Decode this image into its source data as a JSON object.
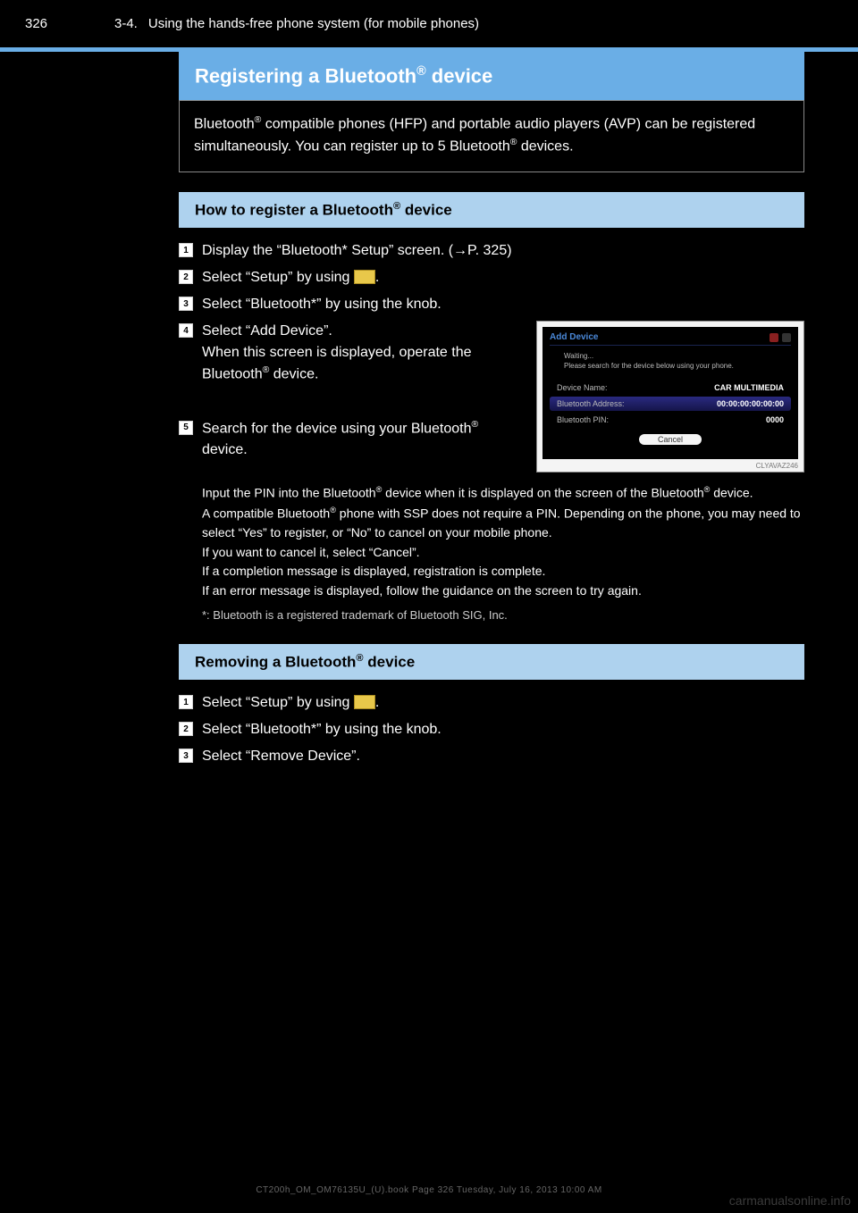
{
  "header": {
    "page_number": "326",
    "section_code": "3-4.",
    "section_title": "Using the hands-free phone system (for mobile phones)"
  },
  "title": {
    "prefix": "Registering a Bluetooth",
    "reg_mark": "®",
    "suffix": " device"
  },
  "intro": {
    "line1_pre": "Bluetooth",
    "line1_post": " compatible phones (HFP) and portable audio players (AVP) can",
    "line2_pre": "be registered simultaneously. You can register up to 5 Bluetooth",
    "line2_post": " devices."
  },
  "sub1": {
    "prefix": "How to register a Bluetooth",
    "suffix": " device"
  },
  "steps1": [
    {
      "n": "1",
      "text": "Display the “Bluetooth* Setup” screen. (→P. 325)"
    },
    {
      "n": "2",
      "text_pre": "Select “Setup” by using ",
      "has_menu_btn": true,
      "text_post": "."
    },
    {
      "n": "3",
      "text": "Select “Bluetooth*” by using the knob."
    },
    {
      "n": "4",
      "text_pre": "Select “Add Device”.",
      "extra": "When this screen is displayed, operate the Bluetooth",
      "reg": "®",
      "extra2": " device."
    },
    {
      "n": "5",
      "text_pre": "Search for the device using your Bluetooth",
      "reg": "®",
      "text_post": " device."
    }
  ],
  "note1": {
    "t1_pre": "Input the PIN into the Bluetooth",
    "t1_post": " device when it is displayed on the screen of the Bluetooth",
    "t1_end": " device.",
    "t2_pre": "A compatible Bluetooth",
    "t2_post": " phone with SSP does not require a PIN. Depending on the phone, you may need to select “Yes” to register, or “No” to cancel on your mobile phone.",
    "t3_pre": "If you want to cancel it, select “Cancel”.",
    "t4_pre": "If a completion message is displayed, registration is complete.",
    "t5_pre": "If an error message is displayed, follow the guidance on the screen to try again.",
    "footnote": "*: Bluetooth is a registered trademark of Bluetooth SIG, Inc."
  },
  "sub2": {
    "prefix": "Removing a Bluetooth",
    "suffix": " device"
  },
  "steps2": [
    {
      "n": "1",
      "text_pre": "Select “Setup” by using ",
      "has_menu_btn": true,
      "text_post": "."
    },
    {
      "n": "2",
      "text": "Select “Bluetooth*” by using the knob."
    },
    {
      "n": "3",
      "text": "Select “Remove Device”."
    }
  ],
  "screenshot": {
    "title": "Add Device",
    "waiting": "Waiting...",
    "prompt": "Please search for the device below using your phone.",
    "rows": [
      {
        "label": "Device Name:",
        "value": "CAR MULTIMEDIA"
      },
      {
        "label": "Bluetooth Address:",
        "value": "00:00:00:00:00:00"
      },
      {
        "label": "Bluetooth PIN:",
        "value": "0000"
      }
    ],
    "cancel": "Cancel",
    "figcode": "CLYAVAZ246"
  },
  "footer": "CT200h_OM_OM76135U_(U).book  Page 326  Tuesday, July 16, 2013  10:00 AM",
  "watermark": "carmanualsonline.info"
}
